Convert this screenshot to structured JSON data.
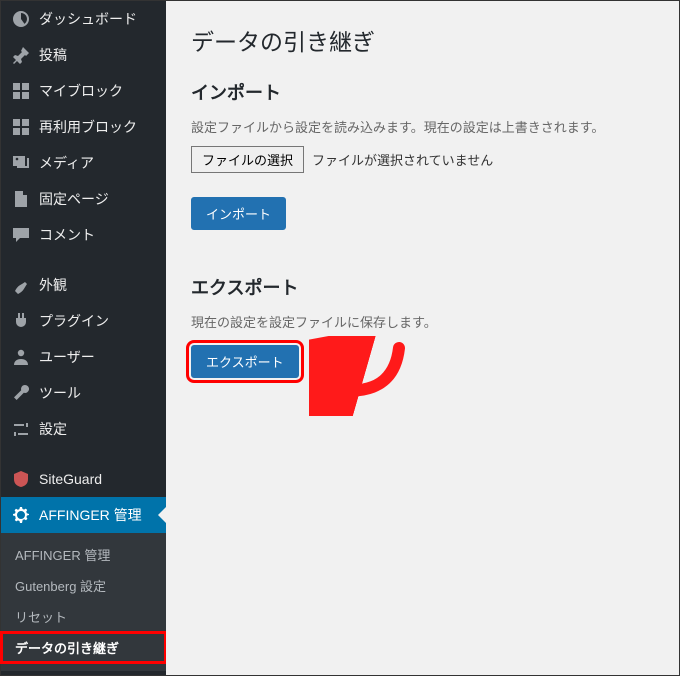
{
  "sidebar": {
    "items": [
      {
        "label": "ダッシュボード",
        "icon": "dashboard-icon"
      },
      {
        "label": "投稿",
        "icon": "pin-icon"
      },
      {
        "label": "マイブロック",
        "icon": "grid-icon"
      },
      {
        "label": "再利用ブロック",
        "icon": "reblock-icon"
      },
      {
        "label": "メディア",
        "icon": "media-icon"
      },
      {
        "label": "固定ページ",
        "icon": "page-icon"
      },
      {
        "label": "コメント",
        "icon": "comment-icon"
      },
      {
        "label": "外観",
        "icon": "appearance-icon"
      },
      {
        "label": "プラグイン",
        "icon": "plugin-icon"
      },
      {
        "label": "ユーザー",
        "icon": "user-icon"
      },
      {
        "label": "ツール",
        "icon": "tools-icon"
      },
      {
        "label": "設定",
        "icon": "settings-icon"
      },
      {
        "label": "SiteGuard",
        "icon": "siteguard-icon"
      },
      {
        "label": "AFFINGER 管理",
        "icon": "gear-icon"
      }
    ],
    "submenu": [
      {
        "label": "AFFINGER 管理"
      },
      {
        "label": "Gutenberg 設定"
      },
      {
        "label": "リセット"
      },
      {
        "label": "データの引き継ぎ",
        "current": true
      }
    ]
  },
  "main": {
    "title": "データの引き継ぎ",
    "import": {
      "heading": "インポート",
      "desc": "設定ファイルから設定を読み込みます。現在の設定は上書きされます。",
      "choose_label": "ファイルの選択",
      "no_file": "ファイルが選択されていません",
      "button": "インポート"
    },
    "export": {
      "heading": "エクスポート",
      "desc": "現在の設定を設定ファイルに保存します。",
      "button": "エクスポート"
    }
  }
}
